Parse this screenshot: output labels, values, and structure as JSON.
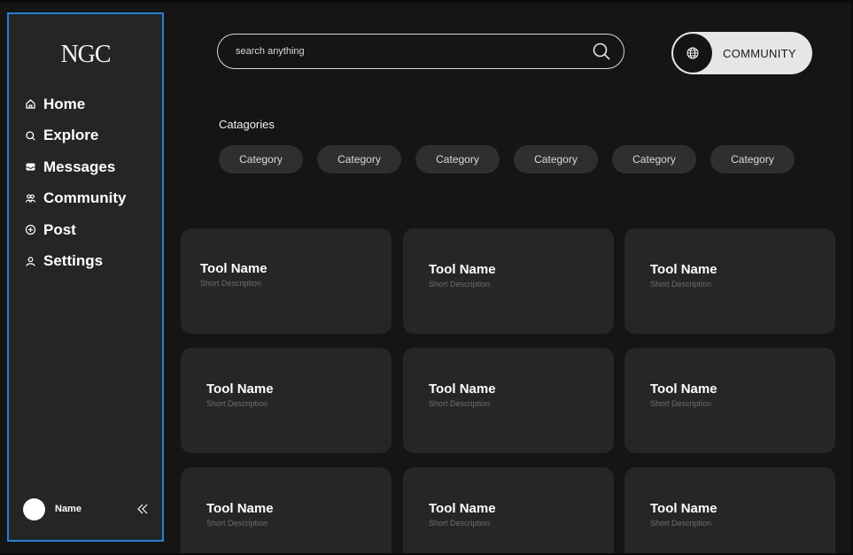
{
  "sidebar": {
    "logo": "NGC",
    "items": [
      {
        "label": "Home",
        "icon": "home-icon"
      },
      {
        "label": "Explore",
        "icon": "search-icon"
      },
      {
        "label": "Messages",
        "icon": "inbox-icon"
      },
      {
        "label": "Community",
        "icon": "people-icon"
      },
      {
        "label": "Post",
        "icon": "plus-circle-icon"
      },
      {
        "label": "Settings",
        "icon": "user-icon"
      }
    ],
    "profile": {
      "name": "Name"
    }
  },
  "header": {
    "search_placeholder": "search anything",
    "community_label": "COMMUNITY"
  },
  "categories": {
    "title": "Catagories",
    "chips": [
      "Category",
      "Category",
      "Category",
      "Category",
      "Category",
      "Category"
    ]
  },
  "tools": [
    {
      "name": "Tool Name",
      "description": "Short Description"
    },
    {
      "name": "Tool Name",
      "description": "Short Description"
    },
    {
      "name": "Tool Name",
      "description": "Short Description"
    },
    {
      "name": "Tool Name",
      "description": "Short Description"
    },
    {
      "name": "Tool Name",
      "description": "Short Description"
    },
    {
      "name": "Tool Name",
      "description": "Short Description"
    },
    {
      "name": "Tool Name",
      "description": "Short Description"
    },
    {
      "name": "Tool Name",
      "description": "Short Description"
    },
    {
      "name": "Tool Name",
      "description": "Short Description"
    }
  ],
  "colors": {
    "background": "#161514",
    "sidebar": "#252525",
    "sidebar_border": "#1f7fdc",
    "card": "#262626",
    "chip": "#2f2f2f",
    "pill": "#e6e6e6"
  }
}
